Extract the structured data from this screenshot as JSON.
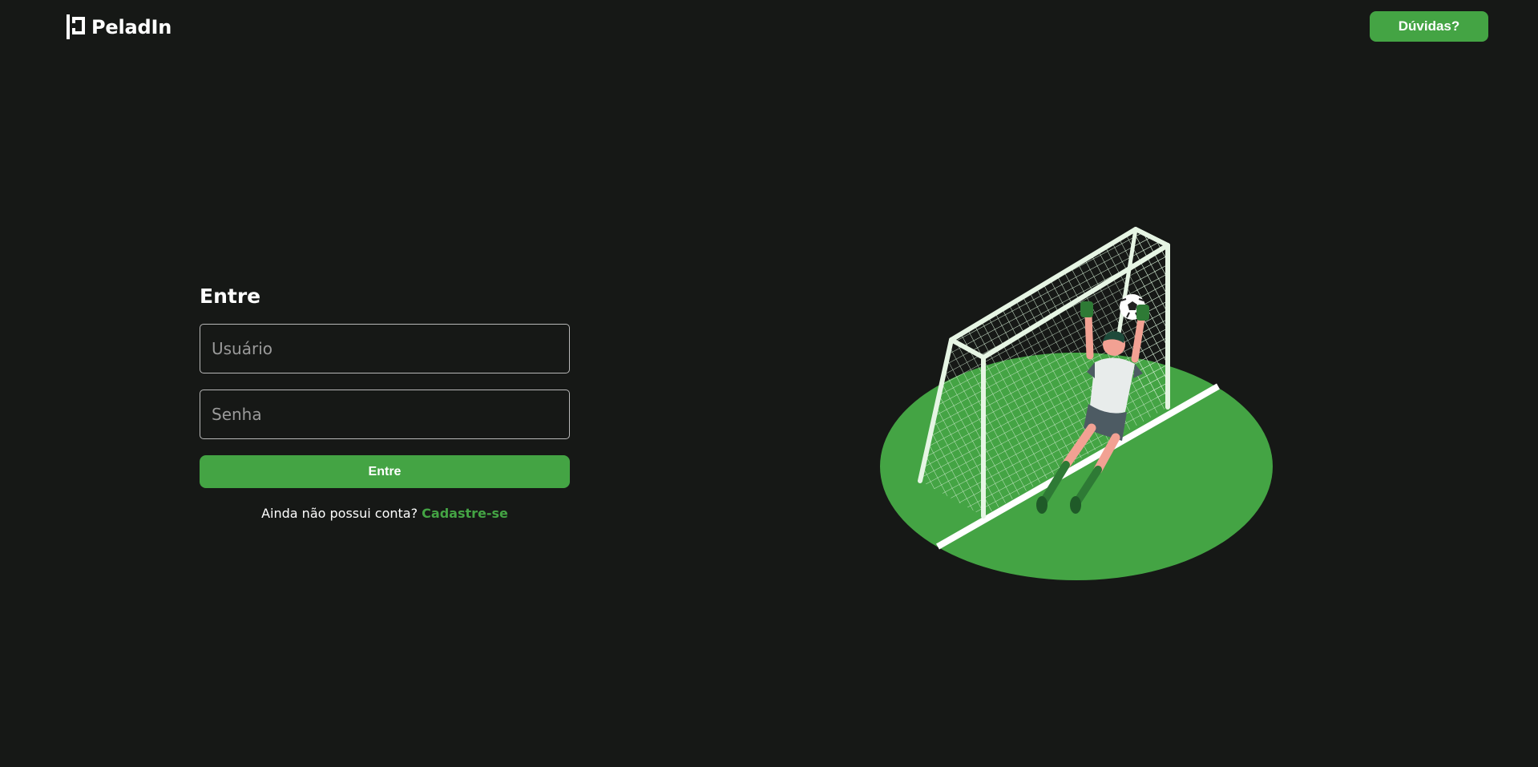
{
  "header": {
    "brand_name": "PeladIn",
    "help_button_label": "Dúvidas?"
  },
  "login": {
    "title": "Entre",
    "username_placeholder": "Usuário",
    "password_placeholder": "Senha",
    "submit_label": "Entre",
    "signup_prompt": "Ainda não possui conta?",
    "signup_link": "Cadastre-se"
  },
  "illustration": {
    "icon": "goalkeeper-illustration"
  },
  "colors": {
    "background": "#161816",
    "accent": "#44a444",
    "text": "#ffffff"
  }
}
